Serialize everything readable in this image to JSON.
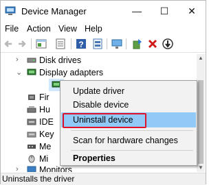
{
  "window": {
    "title": "Device Manager",
    "minimize_glyph": "—",
    "maximize_glyph": "☐",
    "close_glyph": "✕",
    "app_icon": "device-manager-icon"
  },
  "menu": {
    "items": [
      "File",
      "Action",
      "View",
      "Help"
    ]
  },
  "toolbar": {
    "buttons": [
      "back-icon",
      "forward-icon",
      "properties-icon",
      "show-hidden-icon",
      "help-icon",
      "view-resources-icon",
      "scan-hardware-icon",
      "update-driver-icon",
      "uninstall-icon",
      "disable-icon"
    ],
    "back_color": "#b7b7b7",
    "uninstall_color": "#d11b1b"
  },
  "tree": {
    "rows": [
      {
        "label": "Disk drives",
        "icon": "disk-drive-icon",
        "expanded": false
      },
      {
        "label": "Display adapters",
        "icon": "display-adapter-icon",
        "expanded": true
      },
      {
        "label": "",
        "icon": "display-device-icon",
        "selected": true
      },
      {
        "label": "Fir",
        "icon": "firmware-icon",
        "expanded": false
      },
      {
        "label": "Hu",
        "icon": "hid-icon",
        "expanded": false
      },
      {
        "label": "IDE",
        "icon": "ide-icon",
        "expanded": false
      },
      {
        "label": "Key",
        "icon": "keyboard-icon",
        "expanded": false
      },
      {
        "label": "Me",
        "icon": "memory-icon",
        "expanded": false
      },
      {
        "label": "Mi",
        "icon": "mice-icon",
        "expanded": false
      },
      {
        "label": "Monitors",
        "icon": "monitor-icon",
        "expanded": false
      }
    ]
  },
  "context_menu": {
    "items": [
      {
        "label": "Update driver"
      },
      {
        "label": "Disable device"
      },
      {
        "label": "Uninstall device",
        "highlighted": true
      },
      {
        "label": "Scan for hardware changes"
      },
      {
        "label": "Properties",
        "bold": true
      }
    ],
    "highlight_color": "#91c9f7",
    "callout_color": "#e0102b"
  },
  "status": {
    "text": "Uninstalls the driver"
  }
}
